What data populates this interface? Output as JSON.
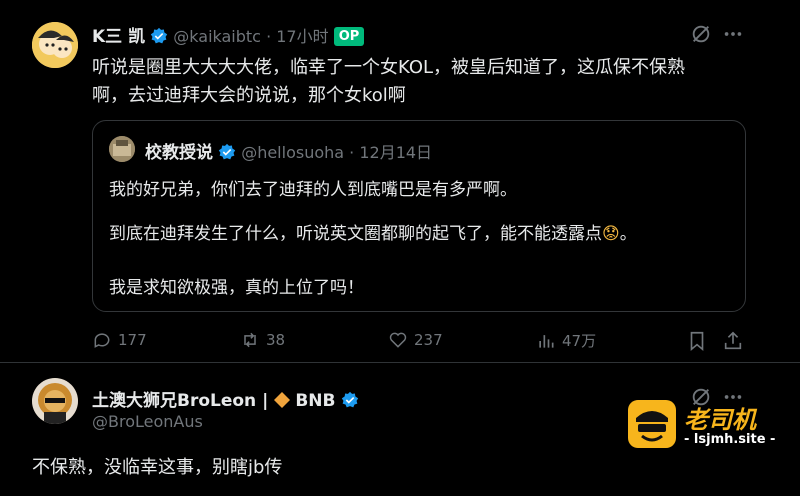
{
  "post": {
    "author_name": "K三 凯",
    "handle": "@kaikaibtc",
    "time": "· 17小时",
    "op_badge": "OP",
    "text_line1": "听说是圈里大大大大佬，临幸了一个女KOL，被皇后知道了，这瓜保不保熟",
    "text_line2": "啊，去过迪拜大会的说说，那个女kol啊"
  },
  "quote": {
    "author_name": "校教授说",
    "handle": "@hellosuoha",
    "date": "· 12月14日",
    "line1": "我的好兄弟，你们去了迪拜的人到底嘴巴是有多严啊。",
    "line2": "到底在迪拜发生了什么，听说英文圈都聊的起飞了，能不能透露点",
    "line2_emoji": "😟",
    "line2_end": "。",
    "line3": "我是求知欲极强，真的上位了吗！"
  },
  "actions": {
    "replies": "177",
    "reposts": "38",
    "likes": "237",
    "views": "47万"
  },
  "reply": {
    "author_name": "土澳大狮兄BroLeon | ",
    "tag": "BNB",
    "handle": "@BroLeonAus",
    "text": "不保熟，没临幸这事，别瞎jb传"
  },
  "watermark": {
    "brand": "老司机",
    "site": "- lsjmh.site -"
  }
}
